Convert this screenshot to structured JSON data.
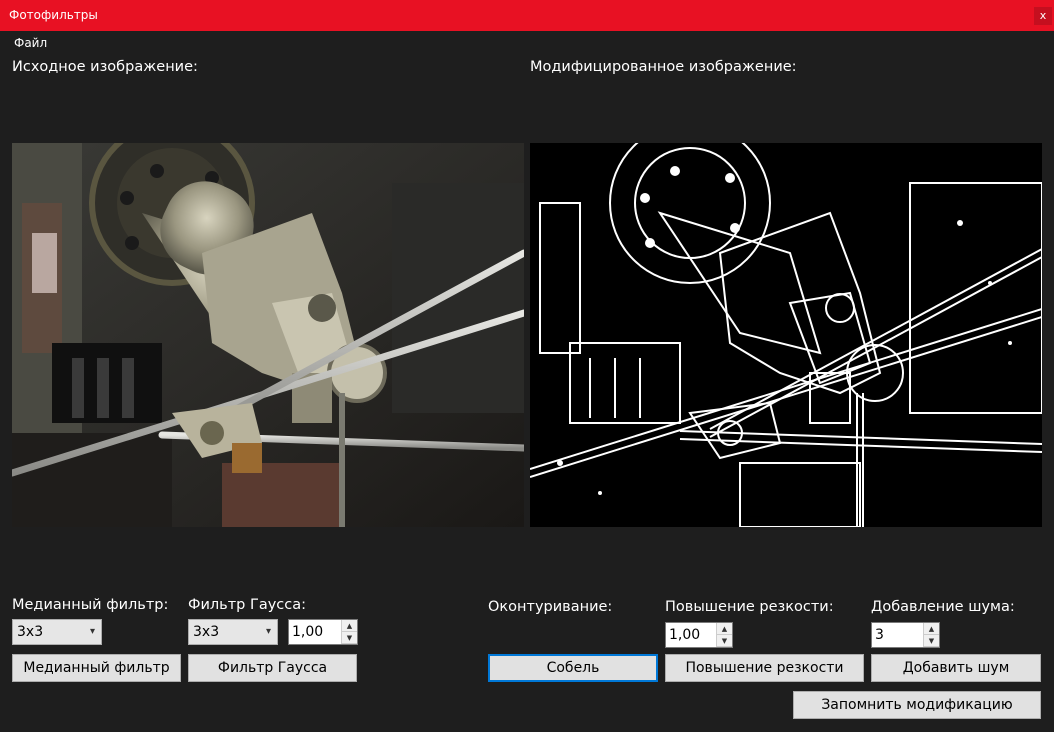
{
  "window": {
    "title": "Фотофильтры",
    "close_label": "x"
  },
  "menu": {
    "file_label": "Файл"
  },
  "panels": {
    "original_label": "Исходное изображение:",
    "modified_label": "Модифицированное изображение:"
  },
  "median": {
    "label": "Медианный фильтр:",
    "kernel_value": "3x3",
    "button_label": "Медианный фильтр"
  },
  "gauss": {
    "label": "Фильтр Гаусса:",
    "kernel_value": "3x3",
    "sigma_value": "1,00",
    "button_label": "Фильтр Гаусса"
  },
  "contour": {
    "label": "Оконтуривание:",
    "button_label": "Собель"
  },
  "sharpen": {
    "label": "Повышение резкости:",
    "value": "1,00",
    "button_label": "Повышение резкости"
  },
  "noise": {
    "label": "Добавление шума:",
    "value": "3",
    "button_label": "Добавить шум"
  },
  "remember_button_label": "Запомнить модификацию",
  "icons": {
    "dropdown": "▾",
    "up": "▲",
    "down": "▼"
  }
}
